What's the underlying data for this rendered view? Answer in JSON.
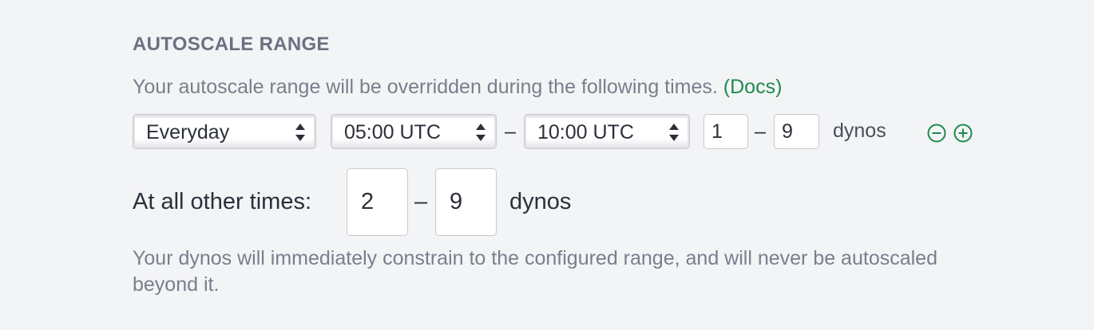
{
  "section": {
    "title": "AUTOSCALE RANGE",
    "description": "Your autoscale range will be overridden during the following times.",
    "docs_link": "(Docs)"
  },
  "override": {
    "day": "Everyday",
    "start_time": "05:00 UTC",
    "time_separator": "–",
    "end_time": "10:00 UTC",
    "min_dynos": "1",
    "dyno_separator": "–",
    "max_dynos": "9",
    "unit": "dynos"
  },
  "other_times": {
    "label": "At all other times:",
    "min_dynos": "2",
    "separator": "–",
    "max_dynos": "9",
    "unit": "dynos"
  },
  "footnote": "Your dynos will immediately constrain to the configured range, and will never be autoscaled beyond it.",
  "colors": {
    "accent": "#1f8a4c",
    "muted_text": "#7a7e8c",
    "heading": "#6c7080",
    "background": "#f3f4f6"
  },
  "icons": {
    "remove": "minus-circle-icon",
    "add": "plus-circle-icon"
  }
}
